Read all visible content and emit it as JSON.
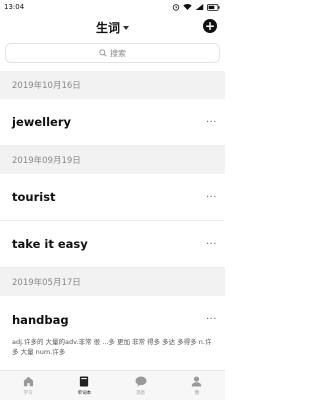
{
  "status_bar": {
    "time": "13:04"
  },
  "header": {
    "title": "生词",
    "add_label": "+"
  },
  "search": {
    "placeholder": "搜索"
  },
  "groups": [
    {
      "date": "2019年10月16日",
      "words": [
        "jewellery"
      ]
    },
    {
      "date": "2019年09月19日",
      "words": [
        "tourist",
        "take it easy"
      ]
    },
    {
      "date": "2019年05月17日",
      "words": [
        "handbag"
      ]
    }
  ],
  "handbag_definition": "adj.许多的 大量的adv.非常 很 ...多 更加 非常 得多 多达 多得多 n.许多 大量 num.许多",
  "more_label": "···",
  "tabs": [
    {
      "label": "学习",
      "icon": "home-icon",
      "active": false
    },
    {
      "label": "单词本",
      "icon": "book-icon",
      "active": true
    },
    {
      "label": "消息",
      "icon": "chat-bubble-icon",
      "active": false
    },
    {
      "label": "我",
      "icon": "person-icon",
      "active": false
    }
  ],
  "colors": {
    "accent": "#111111",
    "date_bg": "#f2f2f2",
    "tab_inactive": "#999999"
  }
}
